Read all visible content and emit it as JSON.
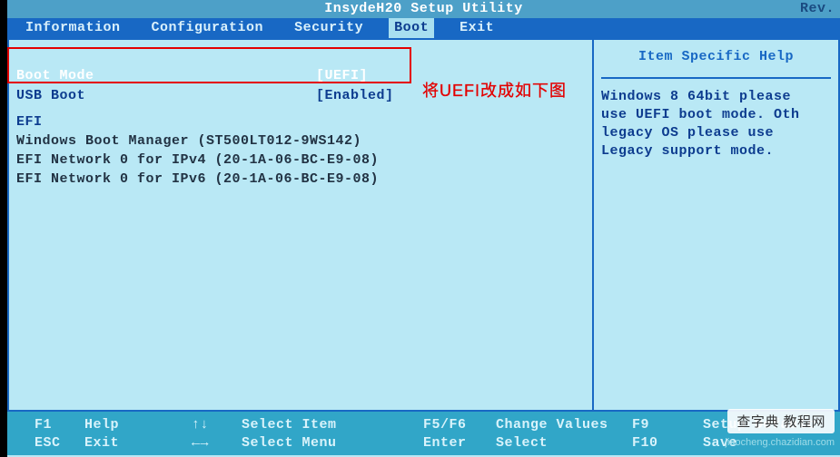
{
  "title": "InsydeH20 Setup Utility",
  "rev": "Rev.",
  "menu": {
    "information": "Information",
    "configuration": "Configuration",
    "security": "Security",
    "boot": "Boot",
    "exit": "Exit"
  },
  "settings": {
    "boot_mode": {
      "label": "Boot Mode",
      "value": "[UEFI]"
    },
    "usb_boot": {
      "label": "USB Boot",
      "value": "[Enabled]"
    }
  },
  "efi_header": "EFI",
  "boot_items": [
    "Windows Boot Manager (ST500LT012-9WS142)",
    "EFI Network 0 for IPv4 (20-1A-06-BC-E9-08)",
    "EFI Network 0 for IPv6 (20-1A-06-BC-E9-08)"
  ],
  "annotation": "将UEFI改成如下图",
  "help": {
    "title": "Item Specific Help",
    "body1": "Windows 8 64bit please",
    "body2": "use UEFI boot mode. Oth",
    "body3": "legacy OS please use",
    "body4": "Legacy support mode."
  },
  "footer": {
    "f1": "F1",
    "f1_label": "Help",
    "updown": "↑↓",
    "updown_label": "Select Item",
    "f5f6": "F5/F6",
    "f5f6_label": "Change Values",
    "f9": "F9",
    "f9_label": "Setup Default",
    "esc": "ESC",
    "esc_label": "Exit",
    "leftright": "←→",
    "leftright_label": "Select Menu",
    "enter": "Enter",
    "enter_label": "Select",
    "f10": "F10",
    "f10_label": "Save"
  },
  "watermark": "查字典 教程网",
  "watermark_sub": "jiaocheng.chazidian.com"
}
